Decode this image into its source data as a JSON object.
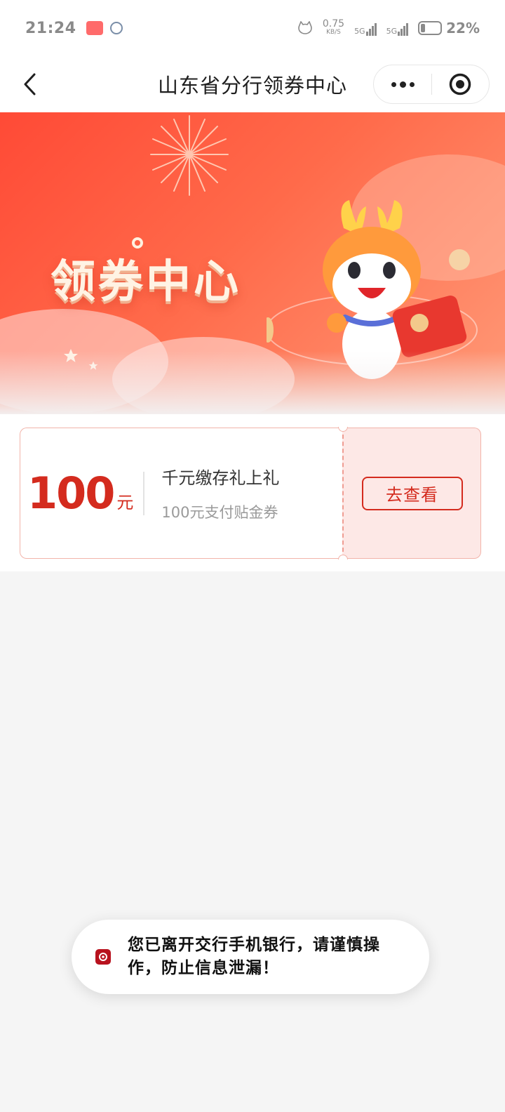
{
  "status_bar": {
    "time": "21:24",
    "net_speed": "0.75",
    "net_unit": "KB/S",
    "signal1_label": "5G",
    "signal2_label": "5G",
    "battery": "22%"
  },
  "navbar": {
    "title": "山东省分行领券中心"
  },
  "banner": {
    "title": "领券中心"
  },
  "coupons": [
    {
      "amount": "100",
      "unit": "元",
      "title": "千元缴存礼上礼",
      "subtitle": "100元支付贴金券",
      "action_label": "去查看"
    }
  ],
  "toast": {
    "message": "您已离开交行手机银行，请谨慎操作，防止信息泄漏！"
  },
  "colors": {
    "accent": "#d42b1e",
    "banner_start": "#ff4a36",
    "coupon_right_bg": "#fde8e6",
    "page_bg": "#f5f5f5"
  }
}
